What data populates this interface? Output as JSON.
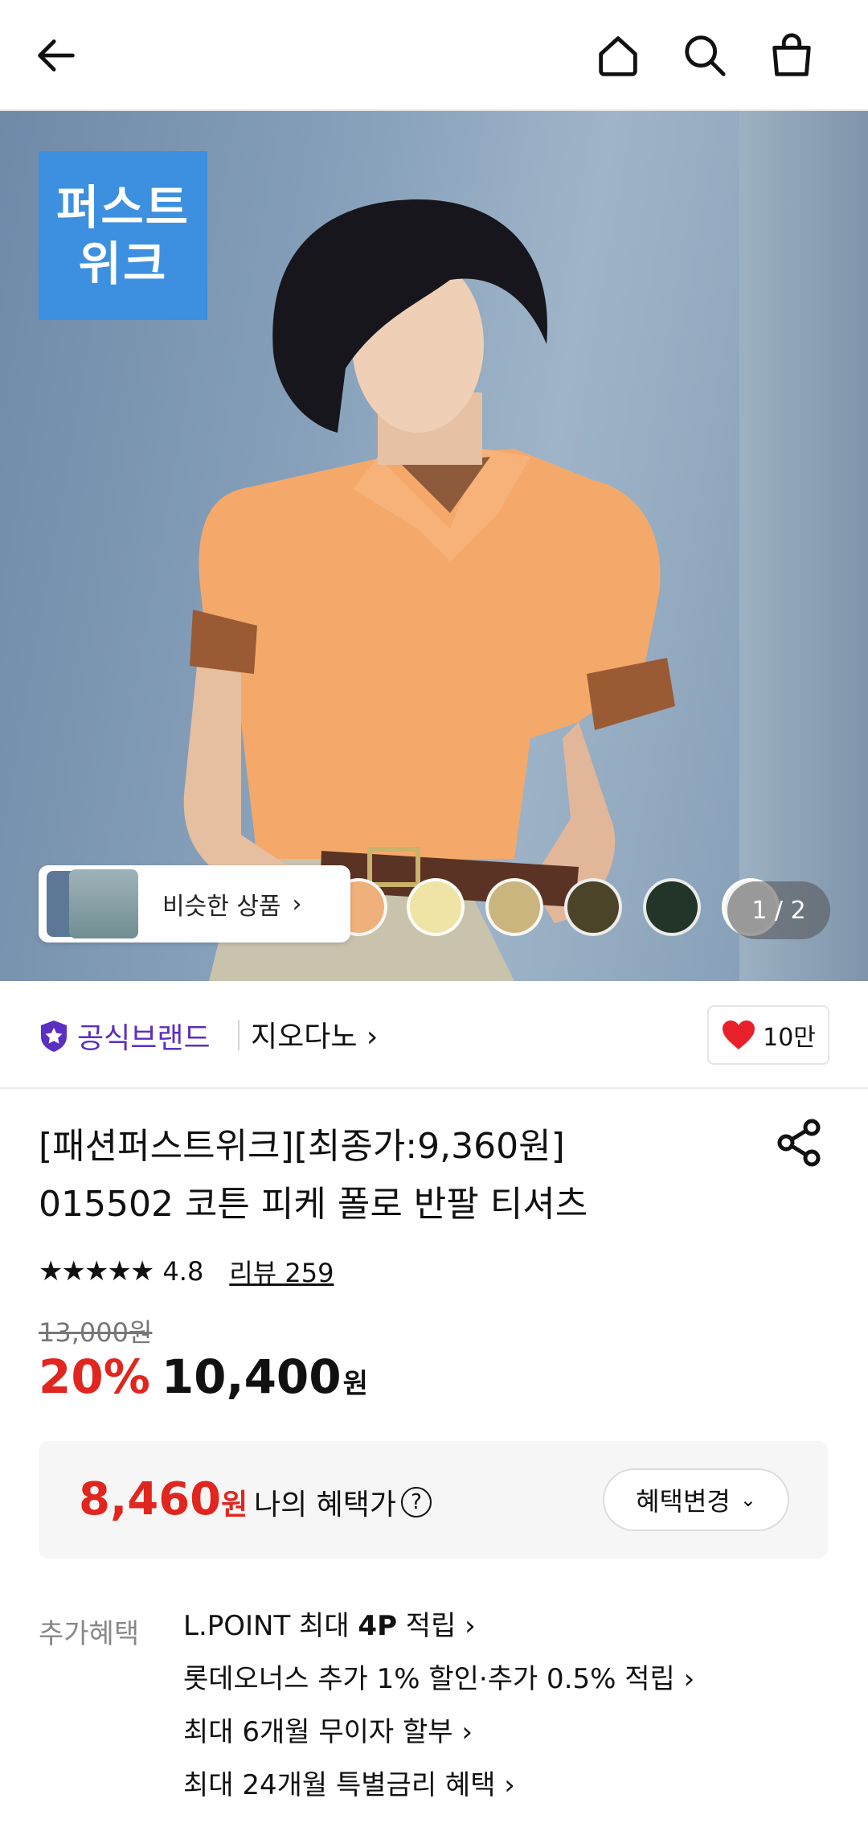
{
  "header": {
    "back_icon": "arrow-left-icon",
    "home_icon": "home-icon",
    "search_icon": "search-icon",
    "cart_icon": "shopping-bag-icon"
  },
  "hero": {
    "brand_badge_line1": "퍼스트",
    "brand_badge_line2": "위크",
    "similar_label": "비슷한 상품",
    "similar_chevron": "›",
    "counter": "1 / 2",
    "swatch_colors": [
      "#f0b07c",
      "#efe4a6",
      "#cbb57e",
      "#4b4429",
      "#233428",
      "#ffffff"
    ]
  },
  "brand": {
    "official_label": "공식브랜드",
    "store_name": "지오다노 ›",
    "likes": "10만",
    "badge_color": "#5a2fc2"
  },
  "product": {
    "title_line1": "[패션퍼스트위크][최종가:9,360원]",
    "title_line2": "015502 코튼 피케 폴로 반팔 티셔츠",
    "stars": "★★★★★",
    "rating": "4.8",
    "reviews": "리뷰 259",
    "original_price": "13,000원",
    "discount": "20%",
    "price": "10,400",
    "price_unit": "원"
  },
  "benefit": {
    "amount": "8,460",
    "amount_unit": "원",
    "label": "나의 혜택가",
    "help": "?",
    "change_button": "혜택변경",
    "change_chevron": "⌄"
  },
  "extra": {
    "label": "추가혜택",
    "item1_pre": "L.POINT 최대 ",
    "item1_bold": "4P",
    "item1_post": " 적립 ›",
    "item2": "롯데오너스 추가 1% 할인·추가 0.5% 적립 ›",
    "item3": "최대 6개월 무이자 할부 ›",
    "item4": "최대 24개월 특별금리 혜택 ›"
  },
  "colors": {
    "accent_red": "#e0261f",
    "brand_purple": "#5a2fc2",
    "badge_blue": "#3d8fe0"
  }
}
